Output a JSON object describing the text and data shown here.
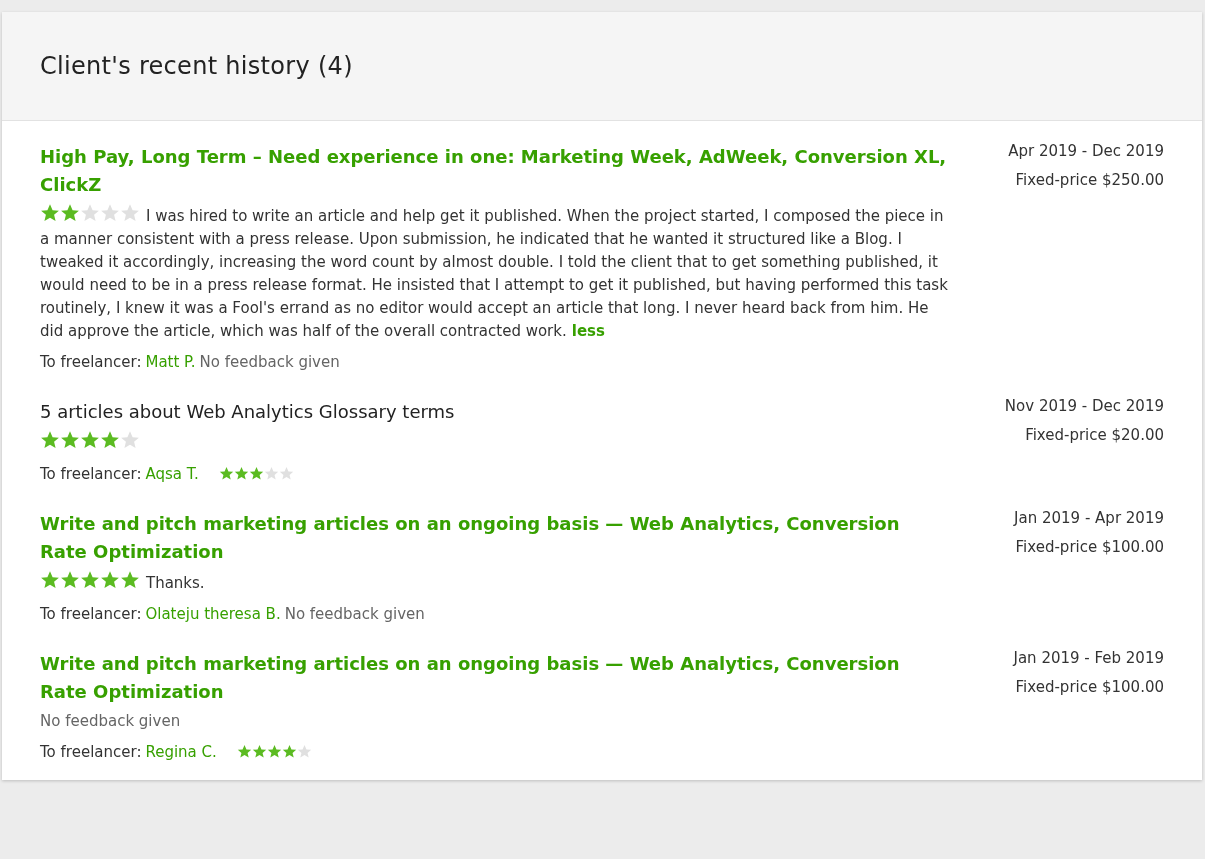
{
  "header": {
    "title": "Client's recent history (4)"
  },
  "jobs": [
    {
      "title": "High Pay, Long Term – Need experience in one: Marketing Week, AdWeek, Conversion XL, ClickZ",
      "title_linked": true,
      "dates": "Apr 2019 - Dec 2019",
      "price": "Fixed-price $250.00",
      "client_feedback": {
        "kind": "stars",
        "stars": 2,
        "comment": "I was hired to write an article and help get it published. When the project started, I composed the piece in a manner consistent with a press release. Upon submission, he indicated that he wanted it structured like a Blog. I tweaked it accordingly, increasing the word count by almost double. I told the client that to get something published, it would need to be in a press release format. He insisted that I attempt to get it published, but having performed this task routinely, I knew it was a Fool's errand as no editor would accept an article that long. I never heard back from him. He did approve the article, which was half of the overall contracted work.",
        "toggle": "less"
      },
      "freelancer_label": "To freelancer:",
      "freelancer": "Matt P.",
      "freelancer_feedback": {
        "kind": "none",
        "text": "No feedback given"
      }
    },
    {
      "title": "5 articles about Web Analytics Glossary terms",
      "title_linked": false,
      "dates": "Nov 2019 - Dec 2019",
      "price": "Fixed-price $20.00",
      "client_feedback": {
        "kind": "stars",
        "stars": 4
      },
      "freelancer_label": "To freelancer:",
      "freelancer": "Aqsa T.",
      "freelancer_feedback": {
        "kind": "stars",
        "stars": 3
      }
    },
    {
      "title": "Write and pitch marketing articles on an ongoing basis — Web Analytics, Conversion Rate Optimization",
      "title_linked": true,
      "dates": "Jan 2019 - Apr 2019",
      "price": "Fixed-price $100.00",
      "client_feedback": {
        "kind": "stars",
        "stars": 5,
        "comment": "Thanks."
      },
      "freelancer_label": "To freelancer:",
      "freelancer": "Olateju theresa B.",
      "freelancer_feedback": {
        "kind": "none",
        "text": "No feedback given"
      }
    },
    {
      "title": "Write and pitch marketing articles on an ongoing basis — Web Analytics, Conversion Rate Optimization",
      "title_linked": true,
      "dates": "Jan 2019 - Feb 2019",
      "price": "Fixed-price $100.00",
      "client_feedback": {
        "kind": "none",
        "text": "No feedback given"
      },
      "freelancer_label": "To freelancer:",
      "freelancer": "Regina C.",
      "freelancer_feedback": {
        "kind": "stars",
        "stars": 4
      }
    }
  ]
}
